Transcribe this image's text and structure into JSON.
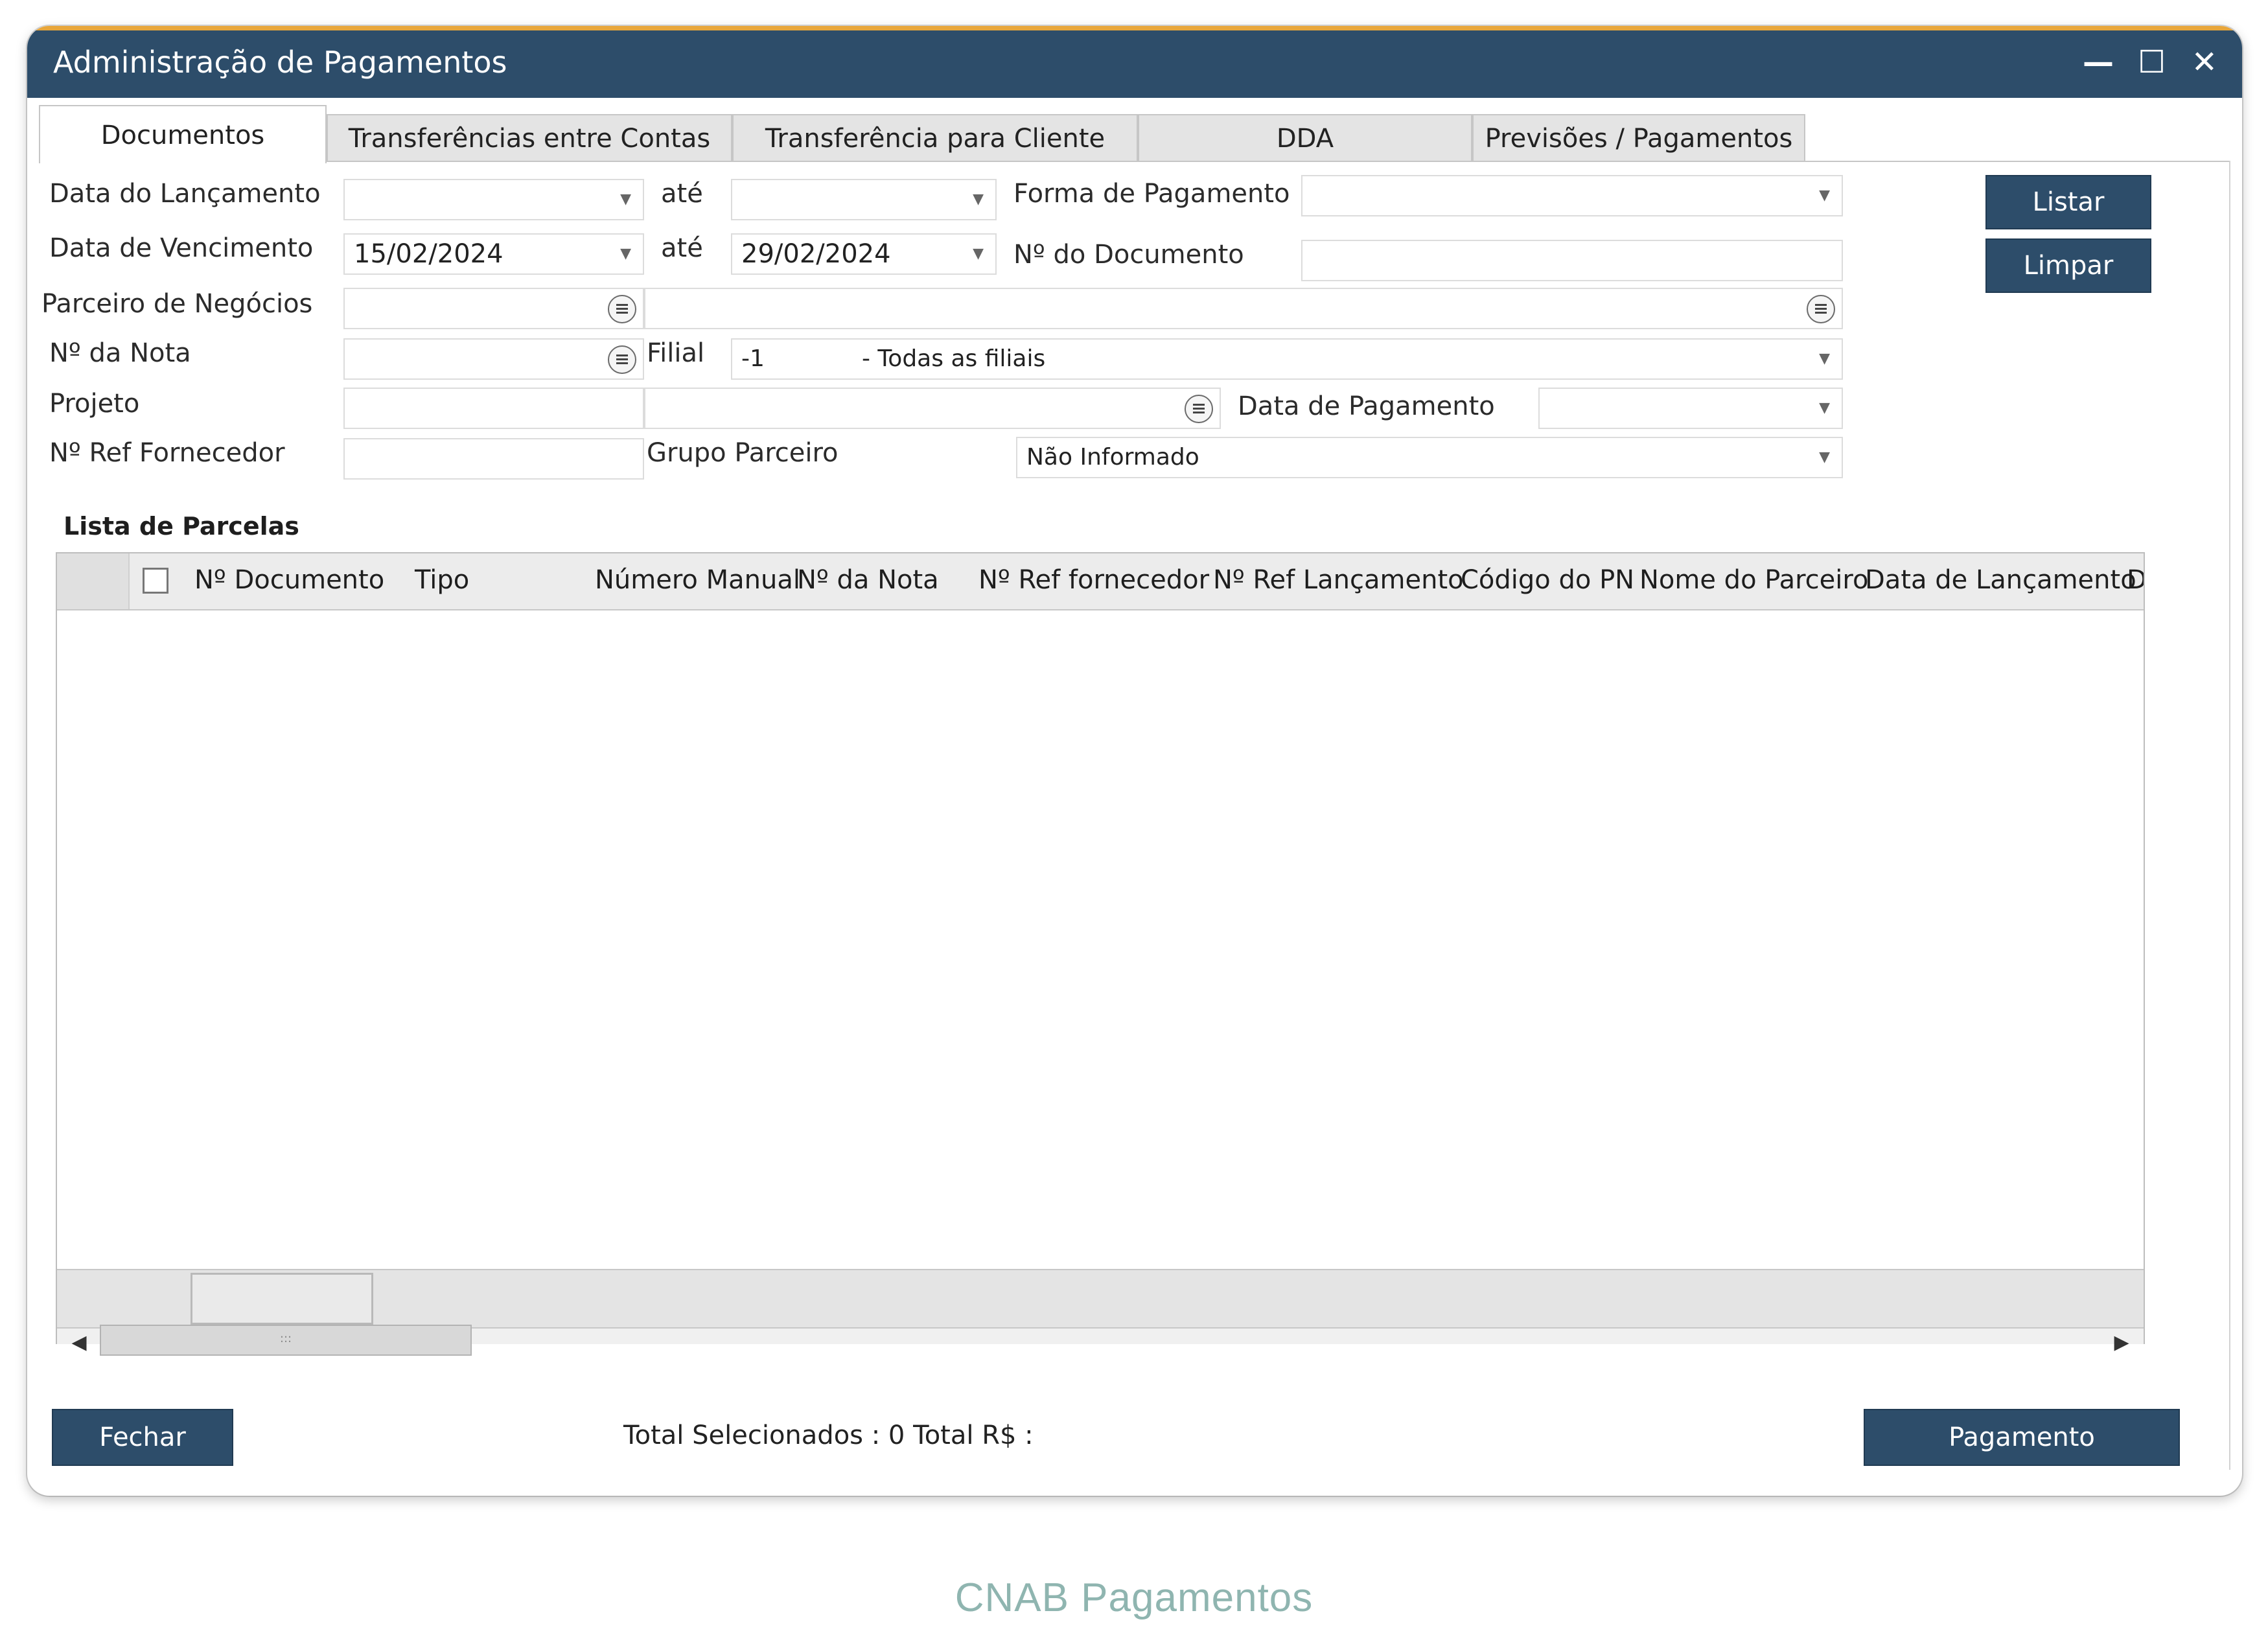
{
  "window": {
    "title": "Administração de Pagamentos",
    "controls": {
      "minimize": "—",
      "maximize": "☐",
      "close": "✕"
    }
  },
  "tabs": [
    {
      "label": "Documentos",
      "active": true
    },
    {
      "label": "Transferências entre Contas",
      "active": false
    },
    {
      "label": "Transferência para Cliente",
      "active": false
    },
    {
      "label": "DDA",
      "active": false
    },
    {
      "label": "Previsões / Pagamentos",
      "active": false
    }
  ],
  "form": {
    "data_lancamento_label": "Data do Lançamento",
    "data_lancamento_from": "",
    "ate_label_1": "até",
    "data_lancamento_to": "",
    "forma_pagamento_label": "Forma de Pagamento",
    "forma_pagamento_value": "",
    "data_vencimento_label": "Data de Vencimento",
    "data_vencimento_from": "15/02/2024",
    "ate_label_2": "até",
    "data_vencimento_to": "29/02/2024",
    "num_documento_label": "Nº do Documento",
    "num_documento_value": "",
    "parceiro_label": "Parceiro de Negócios",
    "parceiro_code": "",
    "parceiro_name": "",
    "num_nota_label": "Nº da Nota",
    "num_nota_value": "",
    "filial_label": "Filial",
    "filial_code": "-1",
    "filial_name": "- Todas as filiais",
    "projeto_label": "Projeto",
    "projeto_code": "",
    "projeto_name": "",
    "data_pagamento_label": "Data de Pagamento",
    "data_pagamento_value": "",
    "ref_fornecedor_label": "Nº Ref Fornecedor",
    "ref_fornecedor_value": "",
    "grupo_parceiro_label": "Grupo Parceiro",
    "grupo_parceiro_value": "Não Informado"
  },
  "buttons": {
    "listar": "Listar",
    "limpar": "Limpar",
    "fechar": "Fechar",
    "pagamento": "Pagamento"
  },
  "list": {
    "title": "Lista de Parcelas",
    "columns": [
      "Nº Documento",
      "Tipo",
      "Número Manual",
      "Nº da Nota",
      "Nº Ref fornecedor",
      "Nº Ref Lançamento",
      "Código do PN",
      "Nome do Parceiro",
      "Data de Lançamento",
      "Data"
    ],
    "rows": [],
    "scroll_thumb": ":::"
  },
  "footer": {
    "totals": "Total Selecionados : 0 Total R$ :"
  },
  "caption": "CNAB Pagamentos",
  "colors": {
    "titlebar": "#2d4d6a",
    "accent": "#e8a63a",
    "button": "#2d4d6a",
    "caption": "#8fb5b0"
  }
}
